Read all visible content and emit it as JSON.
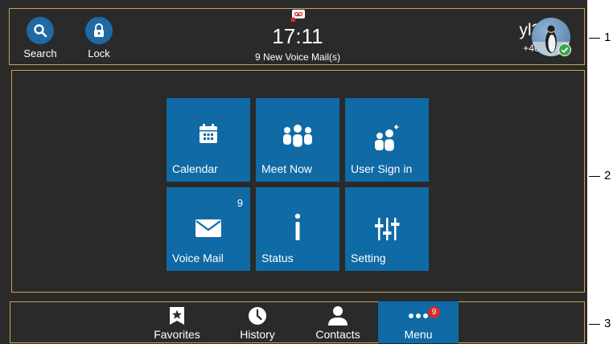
{
  "top_bar": {
    "search_label": "Search",
    "lock_label": "Lock",
    "time": "17:11",
    "notification": "9 New Voice Mail(s)",
    "user_name": "yl38",
    "user_extension": "+4038"
  },
  "tiles": [
    {
      "label": "Calendar",
      "icon": "calendar-icon"
    },
    {
      "label": "Meet Now",
      "icon": "group-icon"
    },
    {
      "label": "User Sign in",
      "icon": "user-sign-in-icon"
    },
    {
      "label": "Voice Mail",
      "icon": "envelope-icon",
      "count": "9"
    },
    {
      "label": "Status",
      "icon": "info-icon"
    },
    {
      "label": "Setting",
      "icon": "sliders-icon"
    }
  ],
  "bottom_nav": {
    "items": [
      {
        "label": "Favorites",
        "icon": "star-bookmark-icon"
      },
      {
        "label": "History",
        "icon": "clock-icon"
      },
      {
        "label": "Contacts",
        "icon": "person-icon"
      },
      {
        "label": "Menu",
        "icon": "dots-icon",
        "badge": "9",
        "active": true
      }
    ]
  },
  "callouts": [
    "1",
    "2",
    "3"
  ],
  "colors": {
    "accent": "#0f6aa5",
    "background": "#2a2a2a",
    "badge": "#d52b2b",
    "frame": "#c9a84a"
  }
}
